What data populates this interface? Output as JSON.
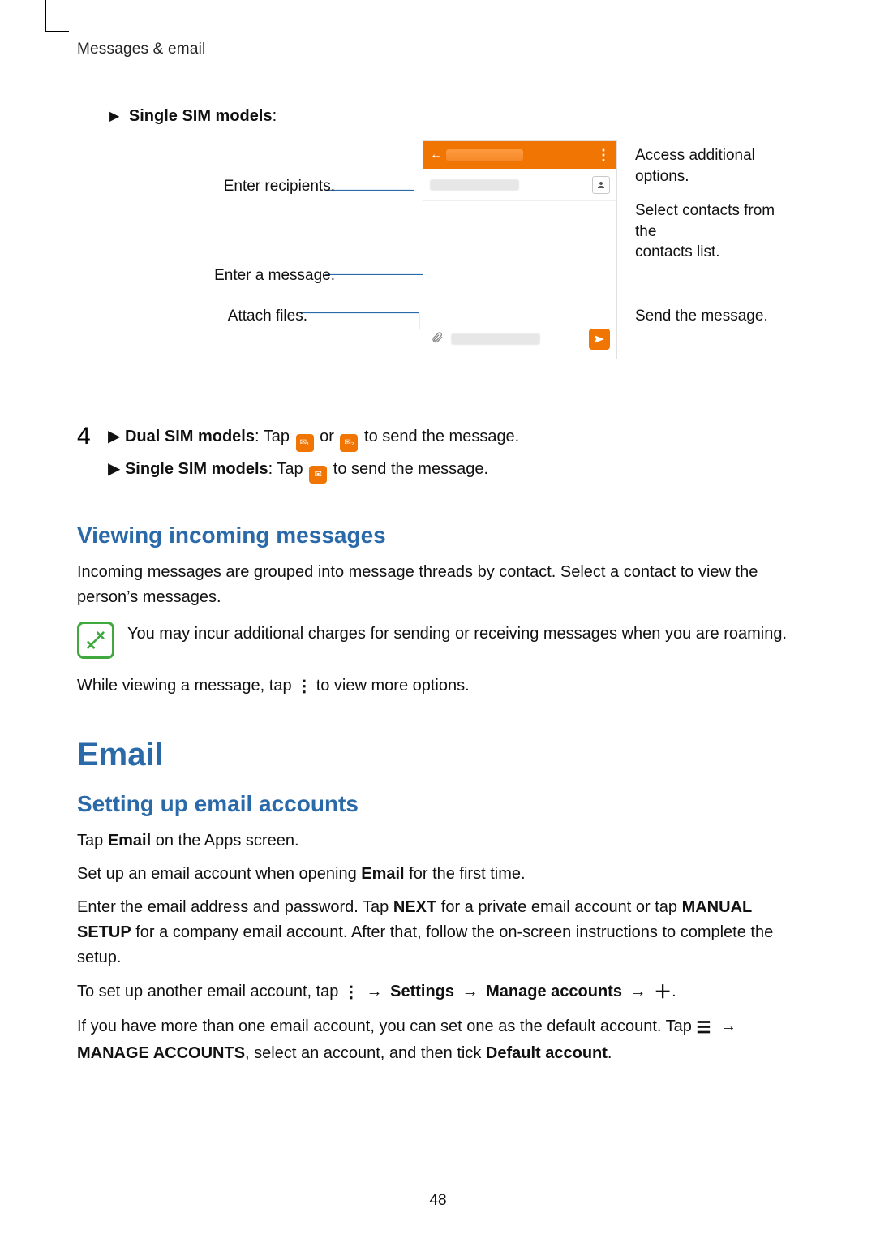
{
  "header": {
    "crumb": "Messages & email"
  },
  "single_sim_label": "Single SIM models",
  "diagram": {
    "callouts": {
      "recipients": "Enter recipients.",
      "message": "Enter a message.",
      "attach": "Attach files.",
      "options": "Access additional options.",
      "contacts_l1": "Select contacts from the",
      "contacts_l2": "contacts list.",
      "send": "Send the message."
    }
  },
  "step4": {
    "num": "4",
    "dual_label": "Dual SIM models",
    "dual_tail_pre": ": Tap ",
    "dual_or": " or ",
    "dual_tail_post": " to send the message.",
    "single_label": "Single SIM models",
    "single_tail_pre": ": Tap ",
    "single_tail_post": " to send the message."
  },
  "viewing": {
    "title": "Viewing incoming messages",
    "body": "Incoming messages are grouped into message threads by contact. Select a contact to view the person’s messages.",
    "note": "You may incur additional charges for sending or receiving messages when you are roaming.",
    "while_pre": "While viewing a message, tap ",
    "while_post": " to view more options."
  },
  "email": {
    "title": "Email",
    "sub": "Setting up email accounts",
    "p1_pre": "Tap ",
    "p1_bold": "Email",
    "p1_post": " on the Apps screen.",
    "p2_pre": "Set up an email account when opening ",
    "p2_bold": "Email",
    "p2_post": " for the first time.",
    "p3_a": "Enter the email address and password. Tap ",
    "p3_next": "NEXT",
    "p3_b": " for a private email account or tap ",
    "p3_manual": "MANUAL SETUP",
    "p3_c": " for a company email account. After that, follow the on-screen instructions to complete the setup.",
    "p4_a": "To set up another email account, tap ",
    "p4_settings": "Settings",
    "p4_manage": "Manage accounts",
    "p4_end": ".",
    "p5_a": "If you have more than one email account, you can set one as the default account. Tap ",
    "p5_manage": "MANAGE ACCOUNTS",
    "p5_b": ", select an account, and then tick ",
    "p5_default": "Default account",
    "p5_c": "."
  },
  "arrow": "→",
  "page_number": "48"
}
